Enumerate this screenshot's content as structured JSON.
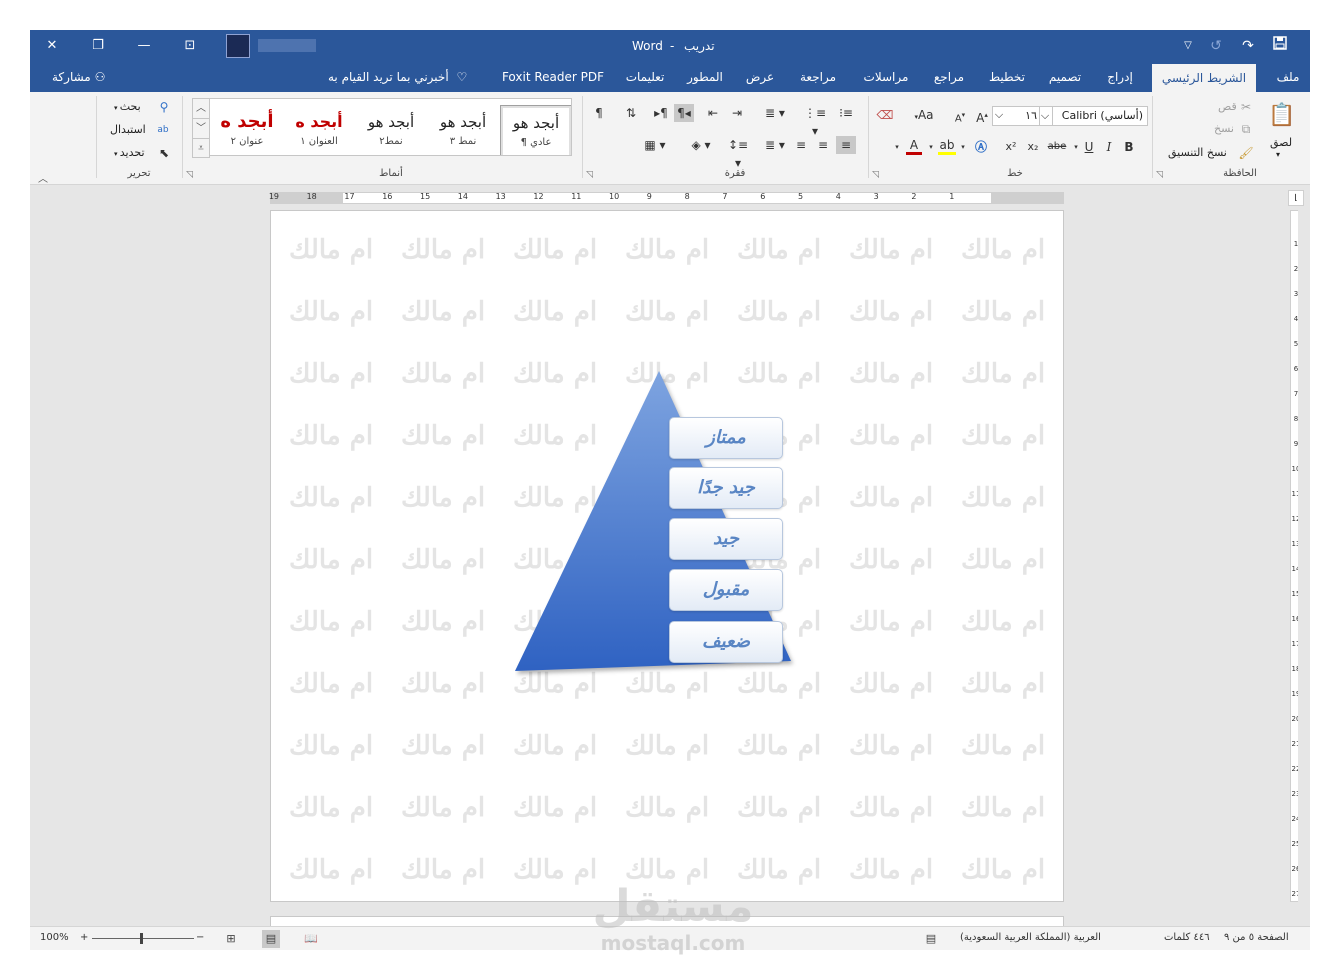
{
  "app": {
    "title": "Word",
    "doc_name": "تدريب",
    "separator": "-",
    "colors": {
      "brand": "#2b579a",
      "ribbon": "#f3f3f3",
      "canvas": "#e6e6e6",
      "shape_blue": "#3f6fc6"
    }
  },
  "titlebar_icons": {
    "save": "save-icon",
    "redo": "redo-icon",
    "undo": "undo-icon",
    "customize": "customize-qat-icon",
    "display": "ribbon-display-icon",
    "minimize": "minimize-icon",
    "restore": "restore-icon",
    "close": "close-icon"
  },
  "tabs": [
    {
      "key": "file",
      "label": "ملف"
    },
    {
      "key": "home",
      "label": "الشريط الرئيسي"
    },
    {
      "key": "insert",
      "label": "إدراج"
    },
    {
      "key": "design",
      "label": "تصميم"
    },
    {
      "key": "layout",
      "label": "تخطيط"
    },
    {
      "key": "references",
      "label": "مراجع"
    },
    {
      "key": "mailings",
      "label": "مراسلات"
    },
    {
      "key": "review",
      "label": "مراجعة"
    },
    {
      "key": "view",
      "label": "عرض"
    },
    {
      "key": "developer",
      "label": "المطور"
    },
    {
      "key": "help",
      "label": "تعليمات"
    },
    {
      "key": "foxit",
      "label": "Foxit Reader PDF"
    }
  ],
  "tell_me": "أخبرني بما تريد القيام به",
  "share": "مشاركة",
  "clipboard": {
    "paste": "لصق",
    "cut": "قص",
    "copy": "نسخ",
    "format_painter": "نسخ التنسيق",
    "group": "الحافظة"
  },
  "font": {
    "name": "Calibri (أساسي)",
    "size": "١٦",
    "bold": "B",
    "italic": "I",
    "underline": "U",
    "strike": "abe",
    "subscript": "x₂",
    "superscript": "x²",
    "grow": "A",
    "shrink": "A",
    "case": "Aa",
    "color_a": "A",
    "group": "خط"
  },
  "paragraph": {
    "pilcrow": "¶",
    "group": "فقرة"
  },
  "styles": {
    "items": [
      {
        "preview": "أبجد هو",
        "name": "¶ عادي"
      },
      {
        "preview": "أبجد هو",
        "name": "نمط ٣"
      },
      {
        "preview": "أبجد هو",
        "name": "نمط٢"
      },
      {
        "preview": "أبجد ه",
        "name": "العنوان ١"
      },
      {
        "preview": "أبجد ه",
        "name": "عنوان ٢"
      }
    ],
    "group": "أنماط"
  },
  "editing": {
    "find": "بحث",
    "replace": "استبدال",
    "select": "تحديد",
    "group": "تحرير"
  },
  "ruler": {
    "h_numbers": [
      "1",
      "2",
      "3",
      "4",
      "5",
      "6",
      "7",
      "8",
      "9",
      "10",
      "11",
      "12",
      "13",
      "14",
      "15",
      "16",
      "17",
      "18",
      "19"
    ],
    "v_numbers": [
      "1",
      "2",
      "3",
      "4",
      "5",
      "6",
      "7",
      "8",
      "9",
      "10",
      "11",
      "12",
      "13",
      "14",
      "15",
      "16",
      "17",
      "18",
      "19",
      "20",
      "21",
      "22",
      "23",
      "24",
      "25",
      "26",
      "27"
    ]
  },
  "document": {
    "watermark": "ام مالك",
    "pyramid_levels": [
      "ممتاز",
      "جيد جدًا",
      "جيد",
      "مقبول",
      "ضعيف"
    ]
  },
  "status": {
    "page": "الصفحة ٥ من ٩",
    "words": "٤٤٦ كلمات",
    "language": "العربية (المملكة العربية السعودية)",
    "zoom": "100%",
    "zoom_plus": "+",
    "zoom_minus": "−"
  },
  "site_watermark": {
    "ar": "مستقل",
    "en": "mostaql.com"
  }
}
